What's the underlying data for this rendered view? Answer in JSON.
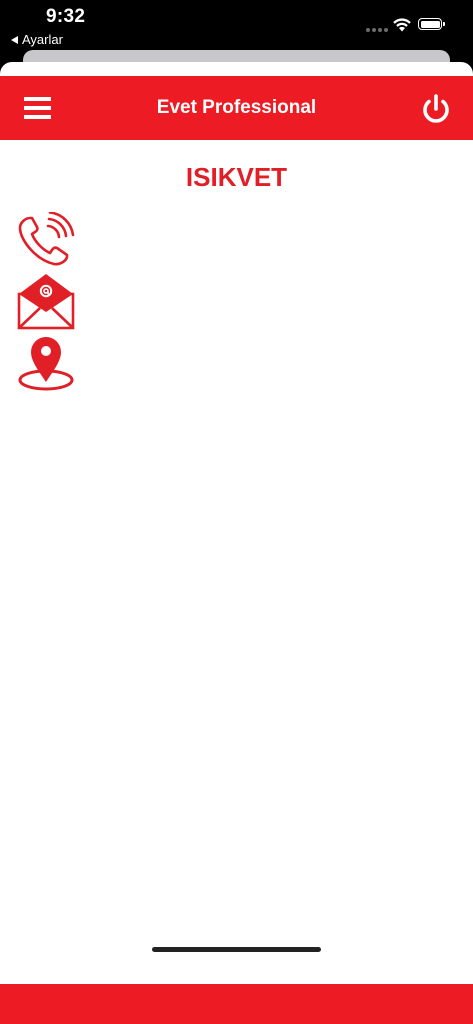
{
  "status_bar": {
    "time": "9:32",
    "back_label": "Ayarlar"
  },
  "nav": {
    "title": "Evet Professional",
    "menu_icon": "hamburger-menu-icon",
    "power_icon": "power-icon"
  },
  "main": {
    "title": "ISIKVET",
    "contacts": [
      {
        "icon": "phone-icon"
      },
      {
        "icon": "email-icon"
      },
      {
        "icon": "location-pin-icon"
      }
    ]
  },
  "colors": {
    "brand_red": "#ed1c24",
    "title_red": "#e01f26"
  }
}
